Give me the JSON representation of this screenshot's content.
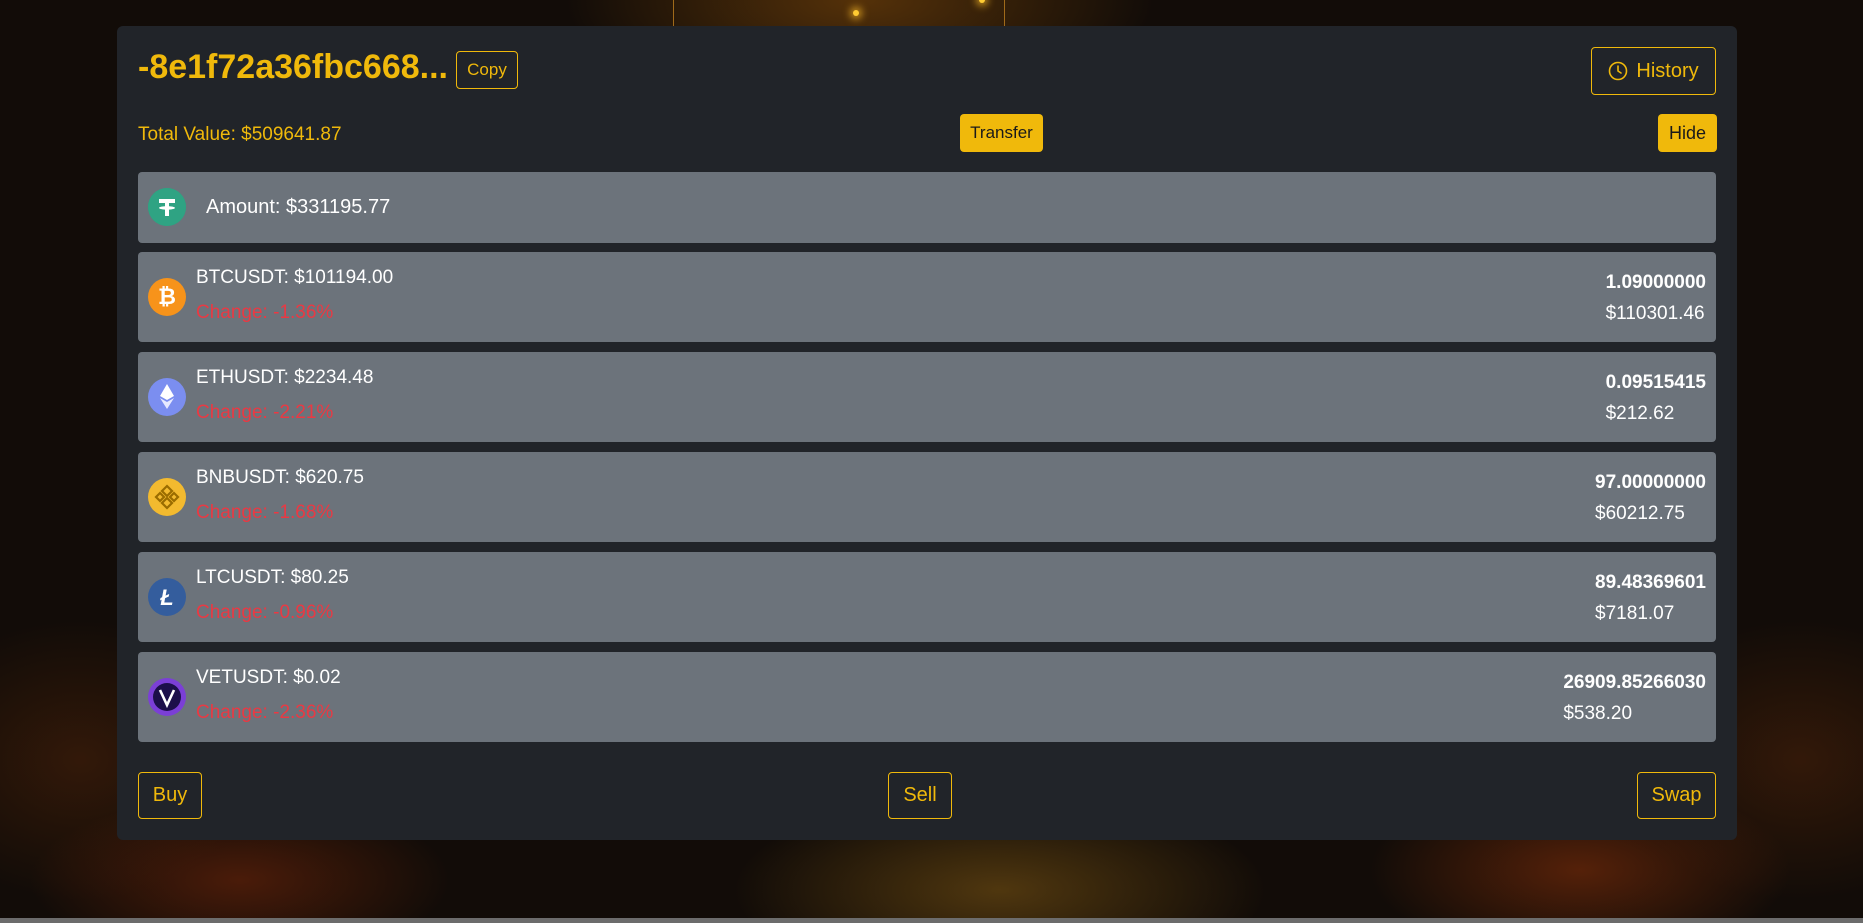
{
  "wallet": {
    "address": "-8e1f72a36fbc668...",
    "copy_label": "Copy",
    "history_label": "History",
    "total_value": "Total Value: $509641.87",
    "transfer_label": "Transfer",
    "hide_label": "Hide"
  },
  "usdt": {
    "amount": "Amount: $331195.77"
  },
  "coins": [
    {
      "pair": "BTCUSDT: $101194.00",
      "change": "Change: -1.36%",
      "qty": "1.09000000",
      "value": "$110301.46",
      "icon": "bitcoin-icon"
    },
    {
      "pair": "ETHUSDT: $2234.48",
      "change": "Change: -2.21%",
      "qty": "0.09515415",
      "value": "$212.62",
      "icon": "ethereum-icon"
    },
    {
      "pair": "BNBUSDT: $620.75",
      "change": "Change: -1.68%",
      "qty": "97.00000000",
      "value": "$60212.75",
      "icon": "bnb-icon"
    },
    {
      "pair": "LTCUSDT: $80.25",
      "change": "Change: -0.96%",
      "qty": "89.48369601",
      "value": "$7181.07",
      "icon": "litecoin-icon"
    },
    {
      "pair": "VETUSDT: $0.02",
      "change": "Change: -2.36%",
      "qty": "26909.85266030",
      "value": "$538.20",
      "icon": "vechain-icon"
    }
  ],
  "actions": {
    "buy": "Buy",
    "sell": "Sell",
    "swap": "Swap"
  },
  "colors": {
    "accent": "#f0b90b",
    "panel": "#212429",
    "row": "#6c737b",
    "negative": "#ea3943"
  }
}
